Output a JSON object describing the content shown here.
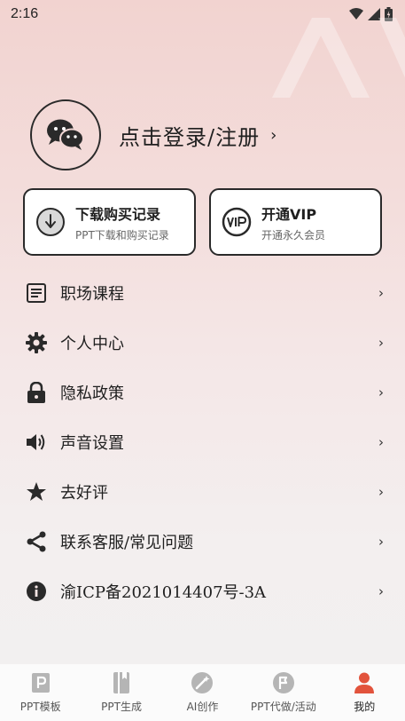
{
  "status_bar": {
    "time": "2:16"
  },
  "profile": {
    "login_text": "点击登录/注册",
    "chevron": "›"
  },
  "cards": [
    {
      "title": "下载购买记录",
      "subtitle": "PPT下载和购买记录",
      "icon": "download-circle-icon"
    },
    {
      "title": "开通VIP",
      "subtitle": "开通永久会员",
      "icon": "vip-badge-icon"
    }
  ],
  "menu": [
    {
      "label": "职场课程",
      "icon": "document-icon"
    },
    {
      "label": "个人中心",
      "icon": "gear-icon"
    },
    {
      "label": "隐私政策",
      "icon": "lock-icon"
    },
    {
      "label": "声音设置",
      "icon": "speaker-icon"
    },
    {
      "label": "去好评",
      "icon": "star-icon"
    },
    {
      "label": "联系客服/常见问题",
      "icon": "share-icon"
    },
    {
      "label": "渝ICP备2021014407号-3A",
      "icon": "info-icon"
    }
  ],
  "menu_chevron": "›",
  "tabbar": [
    {
      "label": "PPT模板",
      "icon": "ppt-template-icon",
      "active": false
    },
    {
      "label": "PPT生成",
      "icon": "ppt-generate-icon",
      "active": false
    },
    {
      "label": "AI创作",
      "icon": "ai-create-icon",
      "active": false
    },
    {
      "label": "PPT代做/活动",
      "icon": "ppt-service-icon",
      "active": false
    },
    {
      "label": "我的",
      "icon": "person-icon",
      "active": true
    }
  ],
  "colors": {
    "active_tab": "#e2533c",
    "inactive_tab": "#b5b5b5",
    "border": "#2a2a2a"
  }
}
